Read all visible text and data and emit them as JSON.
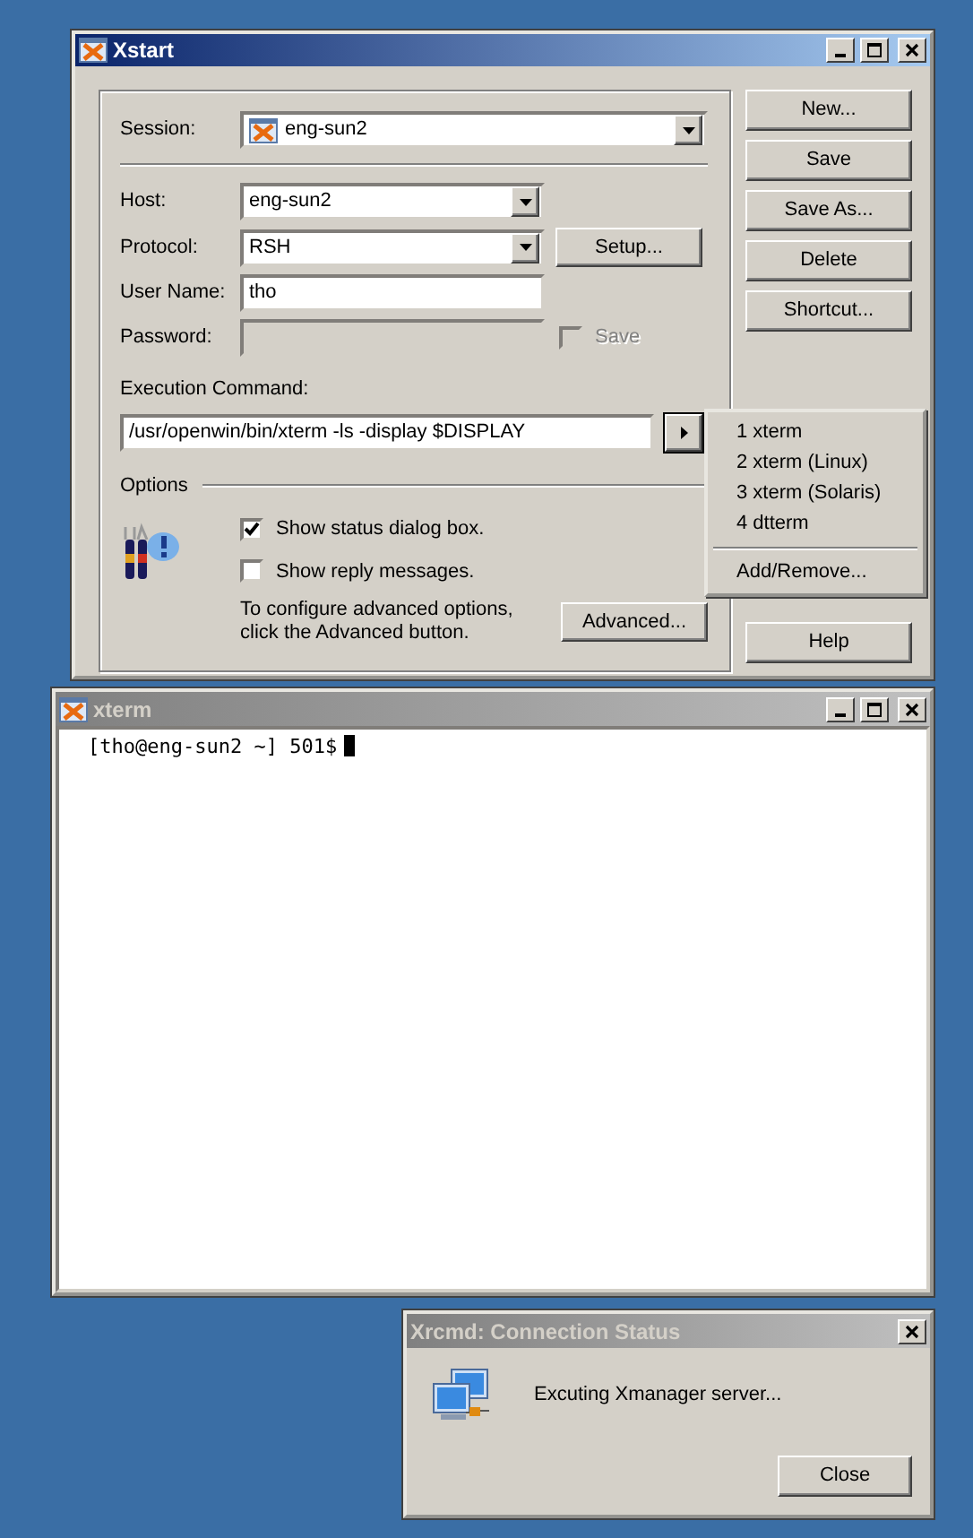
{
  "xstart": {
    "title": "Xstart",
    "active": true,
    "session": {
      "label": "Session:",
      "value": "eng-sun2"
    },
    "fields": [
      {
        "kind": "combo",
        "label": "Host:",
        "value": "eng-sun2"
      },
      {
        "kind": "combo",
        "label": "Protocol:",
        "value": "RSH",
        "button": "Setup..."
      },
      {
        "kind": "text",
        "label": "User Name:",
        "value": "tho"
      },
      {
        "kind": "password",
        "label": "Password:",
        "disabled": true,
        "check": {
          "label": "Save",
          "checked": false,
          "disabled": true
        }
      }
    ],
    "command": {
      "label": "Execution Command:",
      "value": "/usr/openwin/bin/xterm -ls -display $DISPLAY"
    },
    "options": {
      "label": "Options",
      "checkboxes": [
        {
          "label": "Show status dialog box.",
          "checked": true
        },
        {
          "label": "Show reply messages.",
          "checked": false
        }
      ],
      "note": "To configure advanced options,\nclick the Advanced button.",
      "button": "Advanced..."
    },
    "buttons": [
      {
        "label": "New...",
        "kind": "top"
      },
      {
        "label": "Save",
        "kind": "top"
      },
      {
        "label": "Save As...",
        "kind": "top"
      },
      {
        "label": "Delete",
        "kind": "top"
      },
      {
        "label": "Shortcut...",
        "kind": "top"
      },
      {
        "label": "Help",
        "kind": "bottom"
      }
    ],
    "menu": [
      {
        "kind": "item",
        "label": "1 xterm"
      },
      {
        "kind": "item",
        "label": "2 xterm (Linux)"
      },
      {
        "kind": "item",
        "label": "3 xterm (Solaris)"
      },
      {
        "kind": "item",
        "label": "4 dtterm"
      },
      {
        "kind": "separator"
      },
      {
        "kind": "item",
        "label": "Add/Remove..."
      }
    ]
  },
  "xterm": {
    "title": "xterm",
    "active": false,
    "lines": [
      "[tho@eng-sun2 ~] 501$"
    ],
    "cursor": true
  },
  "status": {
    "title": "Xrcmd: Connection Status",
    "active": false,
    "message": "Excuting Xmanager server...",
    "button": "Close"
  }
}
